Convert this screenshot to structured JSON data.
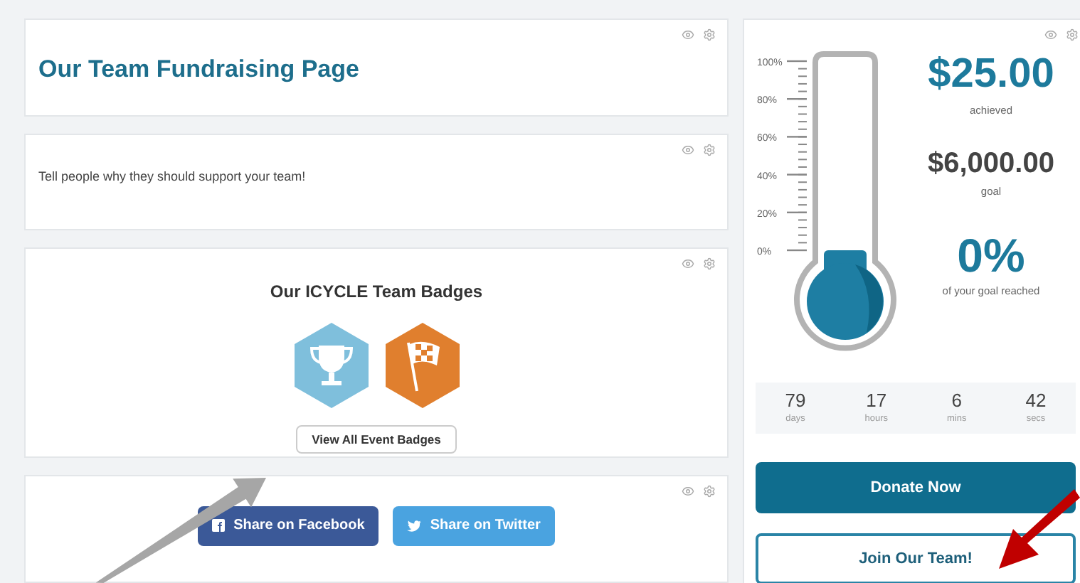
{
  "title_card": {
    "title": "Our Team Fundraising Page"
  },
  "story_card": {
    "text": "Tell people why they should support your team!"
  },
  "badges_card": {
    "heading": "Our ICYCLE Team Badges",
    "badges": [
      {
        "kind": "trophy",
        "color": "#7fbfdc"
      },
      {
        "kind": "flag",
        "color": "#e07f2e"
      }
    ],
    "button": "View All Event Badges"
  },
  "share_card": {
    "buttons": [
      {
        "kind": "facebook",
        "label": "Share on Facebook"
      },
      {
        "kind": "twitter",
        "label": "Share on Twitter"
      }
    ]
  },
  "progress": {
    "ticks": [
      "100%",
      "80%",
      "60%",
      "40%",
      "20%",
      "0%"
    ],
    "achieved": "$25.00",
    "achieved_label": "achieved",
    "goal": "$6,000.00",
    "goal_label": "goal",
    "percent": "0%",
    "percent_label": "of your goal reached"
  },
  "countdown": [
    {
      "value": "79",
      "unit": "days"
    },
    {
      "value": "17",
      "unit": "hours"
    },
    {
      "value": "6",
      "unit": "mins"
    },
    {
      "value": "42",
      "unit": "secs"
    }
  ],
  "donate_button": "Donate Now",
  "join_button": "Join Our Team!"
}
